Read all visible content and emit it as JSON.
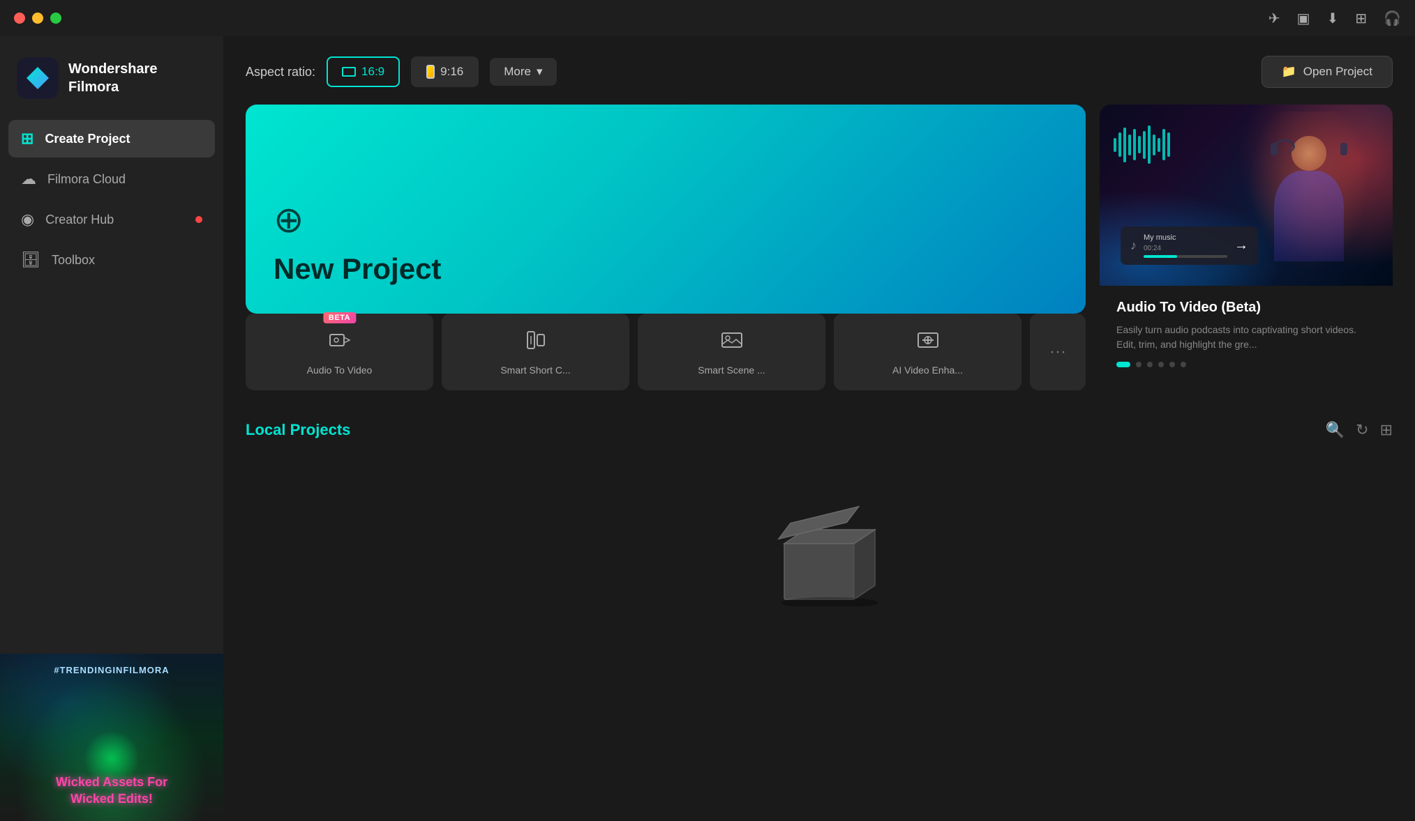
{
  "app": {
    "name": "Wondershare Filmora",
    "name_line1": "Wondershare",
    "name_line2": "Filmora"
  },
  "titlebar": {
    "icons": [
      "send-icon",
      "monitor-icon",
      "download-icon",
      "grid-icon",
      "headphone-icon"
    ]
  },
  "sidebar": {
    "items": [
      {
        "id": "create-project",
        "label": "Create Project",
        "active": true
      },
      {
        "id": "filmora-cloud",
        "label": "Filmora Cloud",
        "active": false
      },
      {
        "id": "creator-hub",
        "label": "Creator Hub",
        "active": false,
        "badge": true
      },
      {
        "id": "toolbox",
        "label": "Toolbox",
        "active": false
      }
    ],
    "thumbnail": {
      "top_text": "#TRENDINGINFILMORA",
      "bottom_text": "Wicked Assets For\nWicked Edits!"
    }
  },
  "aspect_ratio": {
    "label": "Aspect ratio:",
    "options": [
      {
        "id": "16-9",
        "value": "16:9",
        "active": true
      },
      {
        "id": "9-16",
        "value": "9:16",
        "active": false
      }
    ],
    "more_label": "More"
  },
  "open_project": {
    "label": "Open Project"
  },
  "new_project": {
    "title": "New Project"
  },
  "feature_cards": [
    {
      "id": "audio-to-video",
      "label": "Audio To Video",
      "beta": true,
      "icon": "audio-video-icon"
    },
    {
      "id": "smart-short-c",
      "label": "Smart Short C...",
      "beta": false,
      "icon": "smart-short-icon"
    },
    {
      "id": "smart-scene",
      "label": "Smart Scene ...",
      "beta": false,
      "icon": "smart-scene-icon"
    },
    {
      "id": "ai-video-enha",
      "label": "AI Video Enha...",
      "beta": false,
      "icon": "ai-enhance-icon"
    }
  ],
  "showcase": {
    "title": "Audio To Video (Beta)",
    "description": "Easily turn audio podcasts into captivating short videos. Edit, trim, and highlight the gre...",
    "carousel_count": 6,
    "active_dot": 0
  },
  "local_projects": {
    "title": "Local Projects"
  },
  "empty_state": {
    "message": ""
  }
}
